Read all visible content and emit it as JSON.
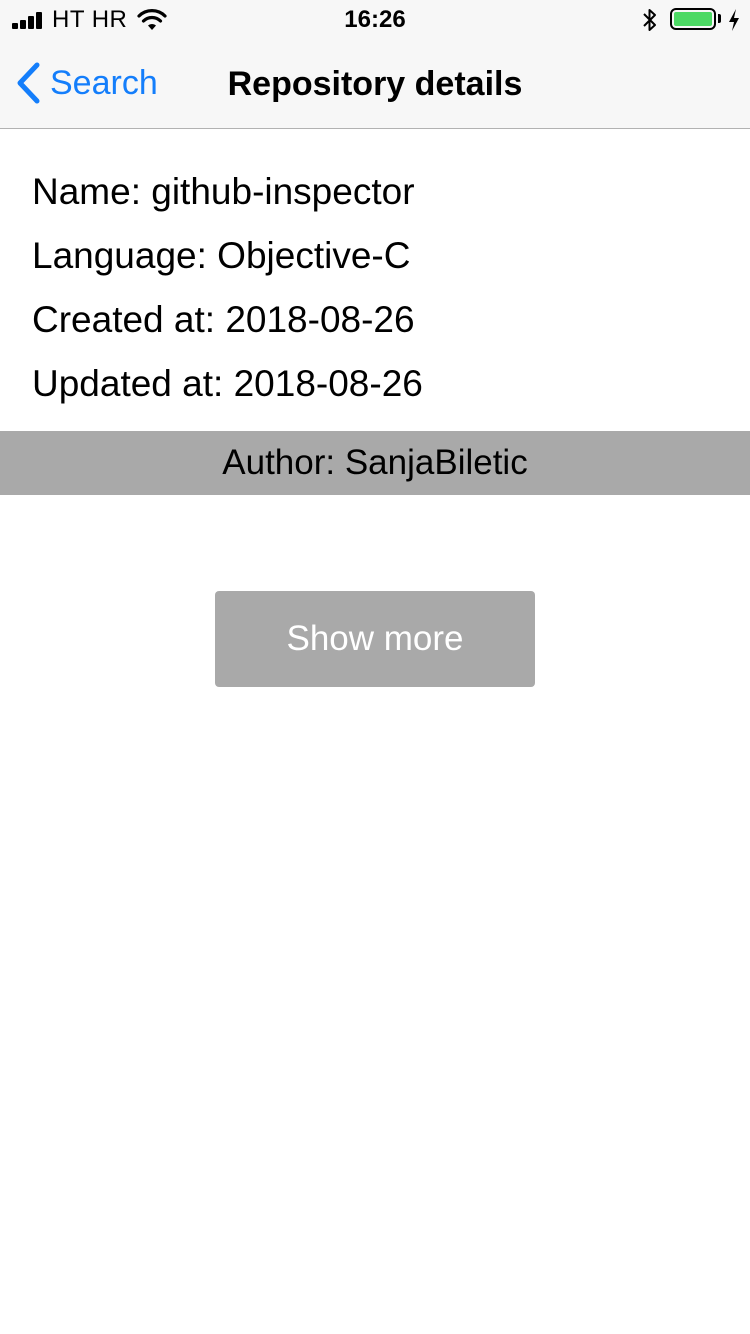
{
  "status_bar": {
    "carrier": "HT HR",
    "time": "16:26",
    "battery_level": 1.0,
    "battery_color": "#4cd964",
    "icons": [
      "signal-icon",
      "wifi-icon",
      "bluetooth-icon",
      "battery-icon",
      "charging-icon"
    ]
  },
  "nav": {
    "back_label": "Search",
    "back_icon": "chevron-left-icon",
    "title": "Repository details",
    "accent_color": "#147efb"
  },
  "repo": {
    "name": "Name: github-inspector",
    "language": "Language: Objective-C",
    "created": "Created at: 2018-08-26",
    "updated": "Updated at: 2018-08-26"
  },
  "author": {
    "label": "Author: SanjaBiletic"
  },
  "actions": {
    "show_more_label": "Show more"
  }
}
